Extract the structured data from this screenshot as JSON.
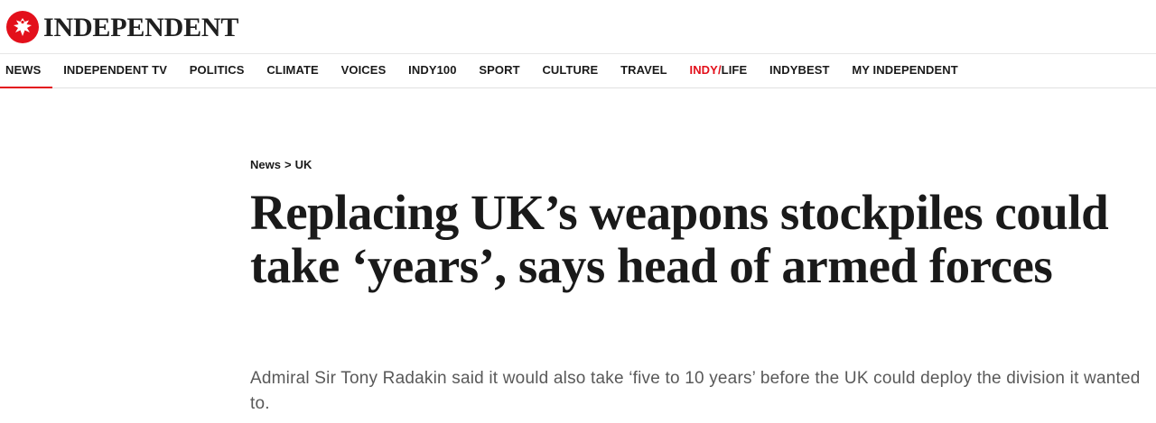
{
  "header": {
    "logo_text": "INDEPENDENT"
  },
  "nav": {
    "items": [
      {
        "label": "NEWS",
        "active": true
      },
      {
        "label": "INDEPENDENT TV"
      },
      {
        "label": "POLITICS"
      },
      {
        "label": "CLIMATE"
      },
      {
        "label": "VOICES"
      },
      {
        "label": "INDY100"
      },
      {
        "label": "SPORT"
      },
      {
        "label": "CULTURE"
      },
      {
        "label": "TRAVEL"
      },
      {
        "label_red": "INDY/",
        "label_rest": "LIFE"
      },
      {
        "label": "INDYBEST"
      },
      {
        "label": "MY INDEPENDENT"
      }
    ]
  },
  "article": {
    "breadcrumb": {
      "section": "News",
      "separator": ">",
      "subsection": "UK"
    },
    "headline": "Replacing UK’s weapons stockpiles could take ‘years’, says head of armed forces",
    "standfirst": "Admiral Sir Tony Radakin said it would also take ‘five to 10 years’ before the UK could deploy the division it wanted to."
  },
  "colors": {
    "brand_red": "#e3101b",
    "text": "#1a1a1a",
    "standfirst": "#595959"
  },
  "icons": {
    "logo": "eagle-icon"
  }
}
